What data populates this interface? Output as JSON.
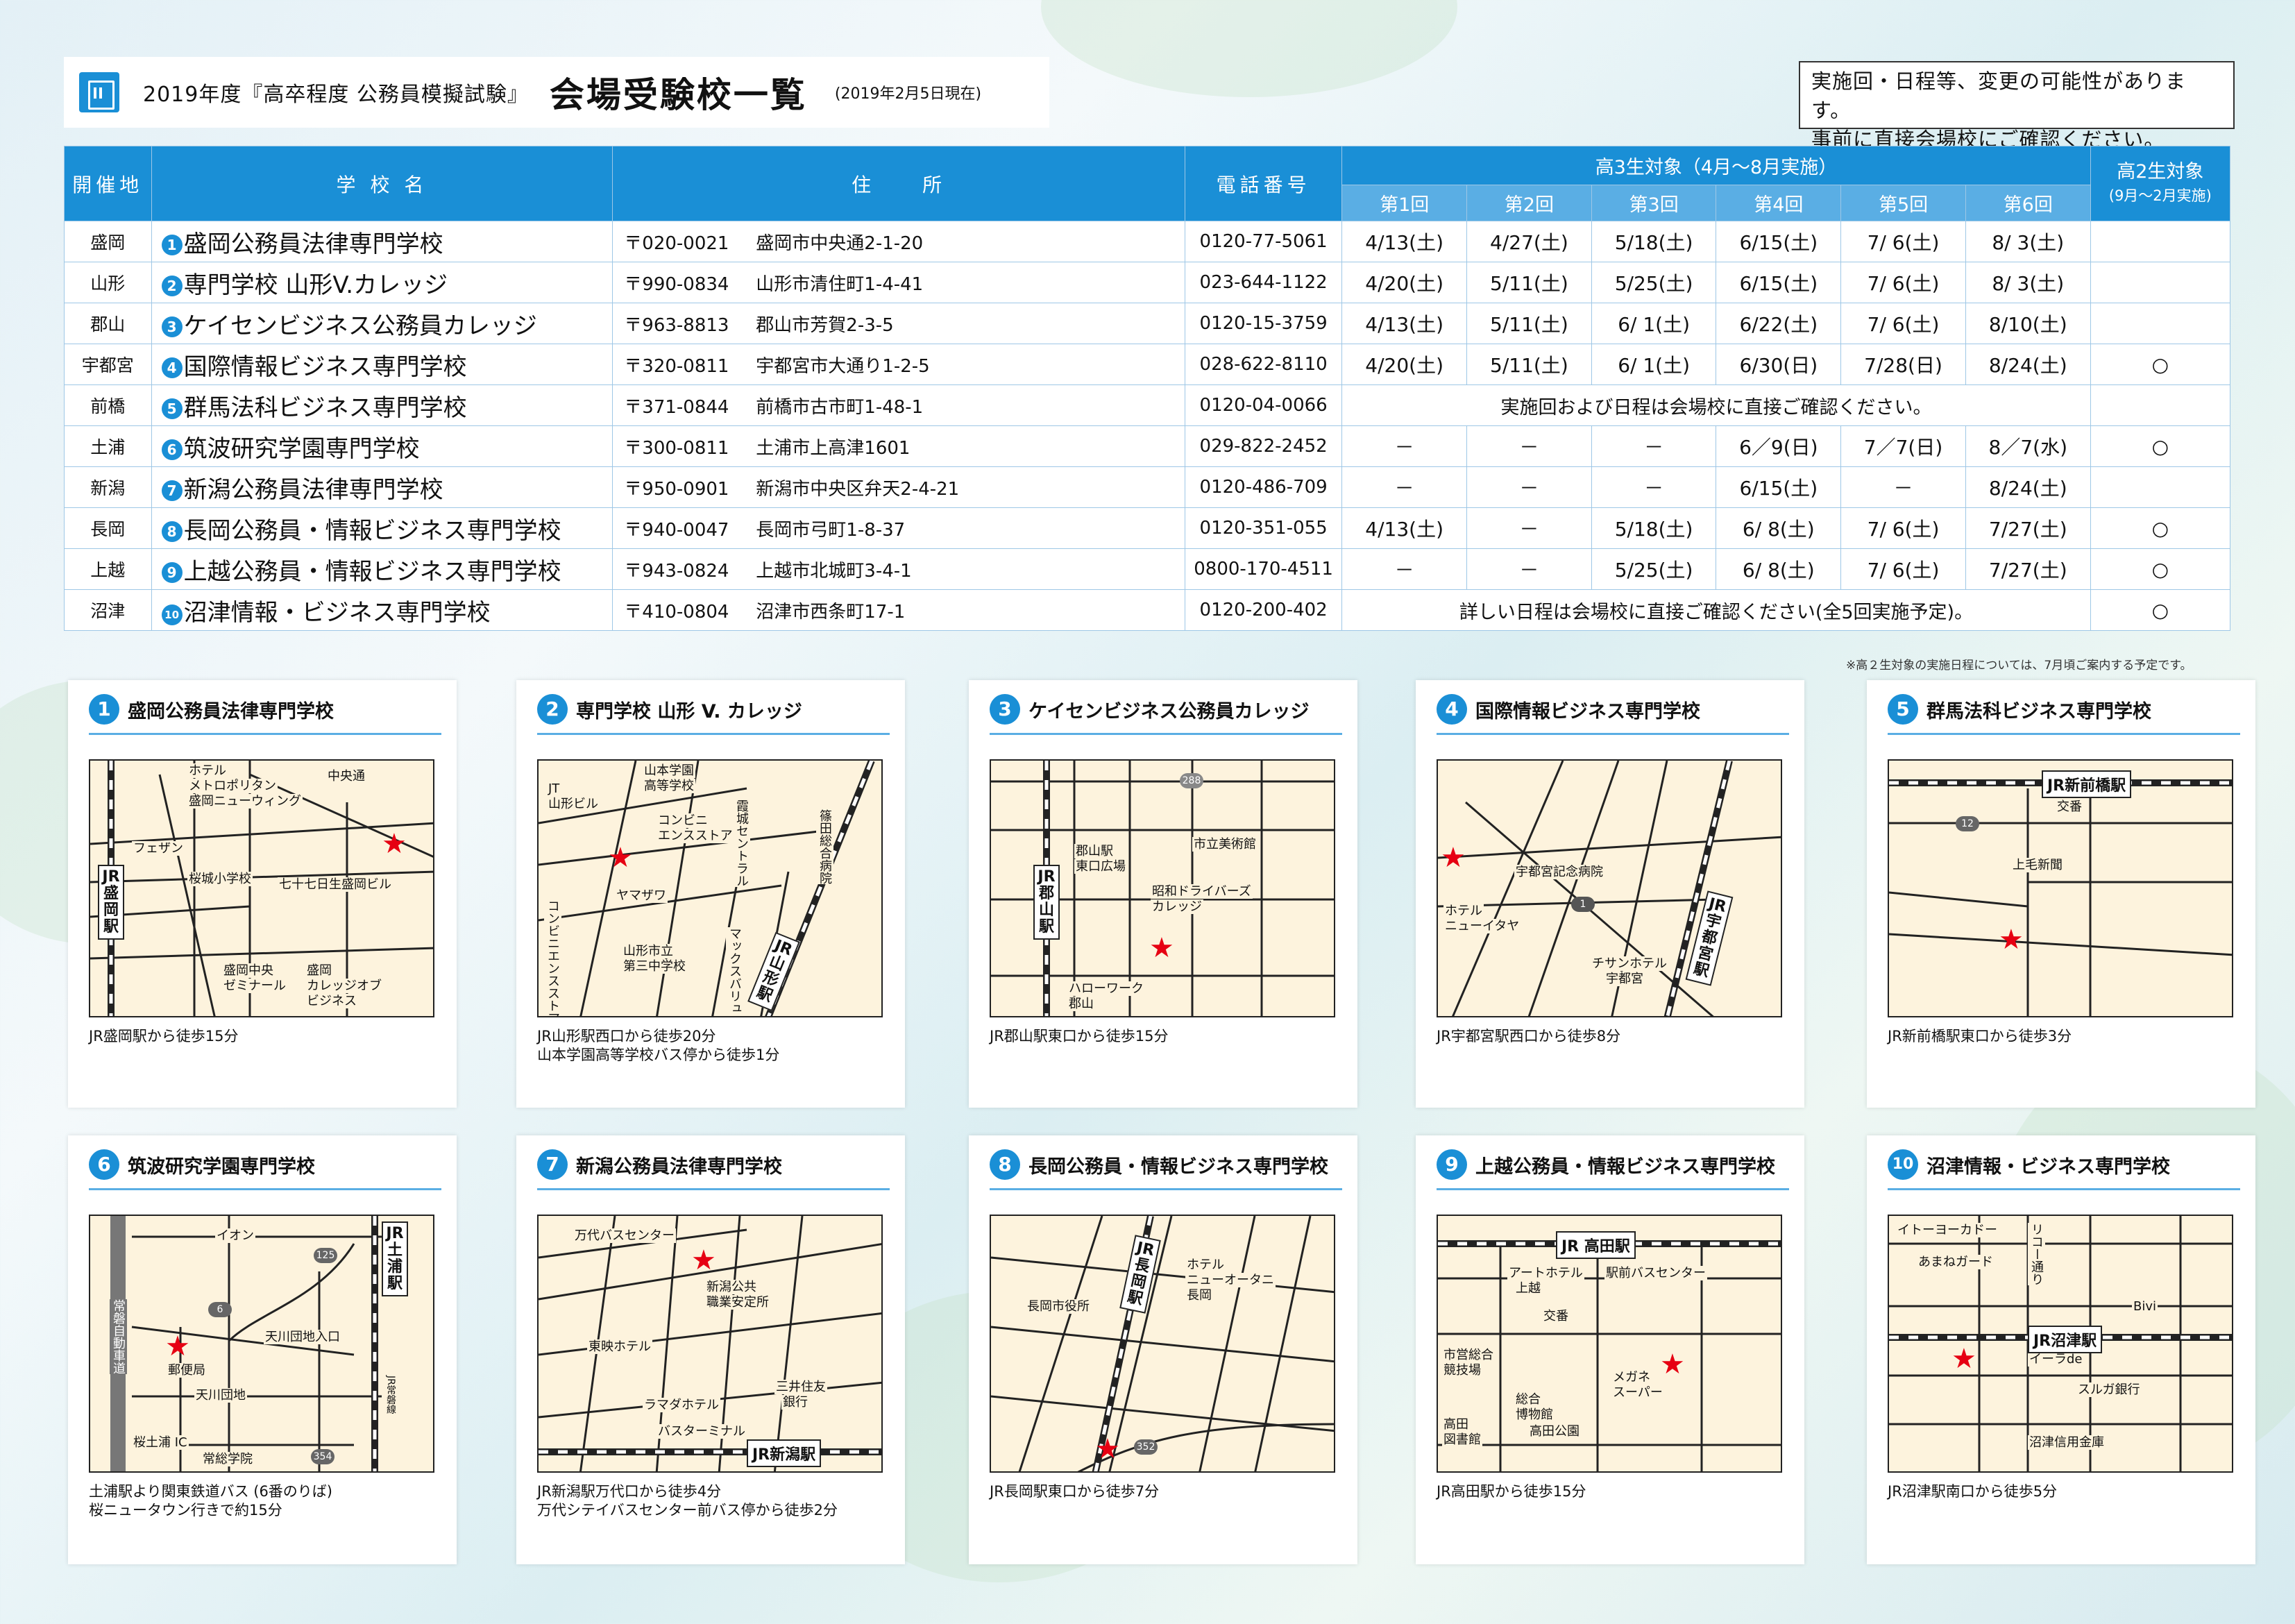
{
  "header": {
    "subtitle": "2019年度『高卒程度 公務員模擬試験』",
    "title": "会場受験校一覧",
    "date": "(2019年2月5日現在)"
  },
  "notice": [
    "実施回・日程等、変更の可能性があります。",
    "事前に直接会場校にご確認ください。"
  ],
  "table": {
    "headers": {
      "place": "開催地",
      "school": "学 校 名",
      "address": "住　　所",
      "phone": "電話番号",
      "g3": "高3生対象（4月～8月実施）",
      "g2": "高2生対象",
      "g2sub": "(9月～2月実施)",
      "rounds": [
        "第1回",
        "第2回",
        "第3回",
        "第4回",
        "第5回",
        "第6回"
      ]
    },
    "rows": [
      {
        "pref": "盛岡",
        "num": "1",
        "school": "盛岡公務員法律専門学校",
        "zip": "〒020-0021",
        "addr": "盛岡市中央通2-1-20",
        "tel": "0120-77-5061",
        "d": [
          "4/13(土)",
          "4/27(土)",
          "5/18(土)",
          "6/15(土)",
          "7/ 6(土)",
          "8/ 3(土)"
        ],
        "k2": ""
      },
      {
        "pref": "山形",
        "num": "2",
        "school": "専門学校 山形V.カレッジ",
        "zip": "〒990-0834",
        "addr": "山形市清住町1-4-41",
        "tel": "023-644-1122",
        "d": [
          "4/20(土)",
          "5/11(土)",
          "5/25(土)",
          "6/15(土)",
          "7/ 6(土)",
          "8/ 3(土)"
        ],
        "k2": ""
      },
      {
        "pref": "郡山",
        "num": "3",
        "school": "ケイセンビジネス公務員カレッジ",
        "zip": "〒963-8813",
        "addr": "郡山市芳賀2-3-5",
        "tel": "0120-15-3759",
        "d": [
          "4/13(土)",
          "5/11(土)",
          "6/ 1(土)",
          "6/22(土)",
          "7/ 6(土)",
          "8/10(土)"
        ],
        "k2": ""
      },
      {
        "pref": "宇都宮",
        "num": "4",
        "school": "国際情報ビジネス専門学校",
        "zip": "〒320-0811",
        "addr": "宇都宮市大通り1-2-5",
        "tel": "028-622-8110",
        "d": [
          "4/20(土)",
          "5/11(土)",
          "6/ 1(土)",
          "6/30(日)",
          "7/28(日)",
          "8/24(土)"
        ],
        "k2": "○"
      },
      {
        "pref": "前橋",
        "num": "5",
        "school": "群馬法科ビジネス専門学校",
        "zip": "〒371-0844",
        "addr": "前橋市古市町1-48-1",
        "tel": "0120-04-0066",
        "merged": "実施回および日程は会場校に直接ご確認ください。",
        "k2": ""
      },
      {
        "pref": "土浦",
        "num": "6",
        "school": "筑波研究学園専門学校",
        "zip": "〒300-0811",
        "addr": "土浦市上高津1601",
        "tel": "029-822-2452",
        "d": [
          "－",
          "－",
          "－",
          "6／9(日)",
          "7／7(日)",
          "8／7(水)"
        ],
        "k2": "○"
      },
      {
        "pref": "新潟",
        "num": "7",
        "school": "新潟公務員法律専門学校",
        "zip": "〒950-0901",
        "addr": "新潟市中央区弁天2-4-21",
        "tel": "0120-486-709",
        "d": [
          "－",
          "－",
          "－",
          "6/15(土)",
          "－",
          "8/24(土)"
        ],
        "k2": ""
      },
      {
        "pref": "長岡",
        "num": "8",
        "school": "長岡公務員・情報ビジネス専門学校",
        "zip": "〒940-0047",
        "addr": "長岡市弓町1-8-37",
        "tel": "0120-351-055",
        "d": [
          "4/13(土)",
          "－",
          "5/18(土)",
          "6/ 8(土)",
          "7/ 6(土)",
          "7/27(土)"
        ],
        "k2": "○"
      },
      {
        "pref": "上越",
        "num": "9",
        "school": "上越公務員・情報ビジネス専門学校",
        "zip": "〒943-0824",
        "addr": "上越市北城町3-4-1",
        "tel": "0800-170-4511",
        "d": [
          "－",
          "－",
          "5/25(土)",
          "6/ 8(土)",
          "7/ 6(土)",
          "7/27(土)"
        ],
        "k2": "○"
      },
      {
        "pref": "沼津",
        "num": "10",
        "school": "沼津情報・ビジネス専門学校",
        "zip": "〒410-0804",
        "addr": "沼津市西条町17-1",
        "tel": "0120-200-402",
        "merged": "詳しい日程は会場校に直接ご確認ください(全5回実施予定)。",
        "k2": "○"
      }
    ]
  },
  "footnote": "※高２生対象の実施日程については、7月頃ご案内する予定です。",
  "maps": [
    {
      "num": "1",
      "title": "盛岡公務員法律専門学校",
      "caption": [
        "JR盛岡駅から徒歩15分"
      ],
      "labels": [
        "ホテル",
        "メトロポリタン",
        "盛岡ニューウィング",
        "中央通",
        "フェザン",
        "桜城小学校",
        "七十七日生盛岡ビル",
        "盛岡中央",
        "ゼミナール",
        "盛岡",
        "カレッジオブ",
        "ビジネス"
      ],
      "station": "JR盛岡駅"
    },
    {
      "num": "2",
      "title": "専門学校 山形 V. カレッジ",
      "caption": [
        "JR山形駅西口から徒歩20分",
        "山本学園高等学校バス停から徒歩1分"
      ],
      "labels": [
        "JT",
        "山形ビル",
        "山本学園",
        "高等学校",
        "コンビニ",
        "エンスストア",
        "霞城セントラル",
        "篠田総合病院",
        "ヤマザワ",
        "コンビニエンスストア",
        "山形市立",
        "第三中学校",
        "マックスバリュ"
      ],
      "station": "JR山形駅"
    },
    {
      "num": "3",
      "title": "ケイセンビジネス公務員カレッジ",
      "caption": [
        "JR郡山駅東口から徒歩15分"
      ],
      "labels": [
        "郡山駅",
        "東口広場",
        "市立美術館",
        "昭和ドライバーズ",
        "カレッジ",
        "ハローワーク",
        "郡山"
      ],
      "station": "JR郡山駅",
      "route": "288"
    },
    {
      "num": "4",
      "title": "国際情報ビジネス専門学校",
      "caption": [
        "JR宇都宮駅西口から徒歩8分"
      ],
      "labels": [
        "宇都宮記念病院",
        "ホテル",
        "ニューイタヤ",
        "チサンホテル",
        "宇都宮"
      ],
      "station": "JR宇都宮駅",
      "route": "1"
    },
    {
      "num": "5",
      "title": "群馬法科ビジネス専門学校",
      "caption": [
        "JR新前橋駅東口から徒歩3分"
      ],
      "labels": [
        "交番",
        "上毛新聞"
      ],
      "station": "JR新前橋駅",
      "route": "12"
    },
    {
      "num": "6",
      "title": "筑波研究学園専門学校",
      "caption": [
        "土浦駅より関東鉄道バス (6番のりば)",
        "桜ニュータウン行きで約15分"
      ],
      "labels": [
        "イオン",
        "天川団地入口",
        "郵便局",
        "天川団地",
        "桜土浦 IC",
        "常総学院",
        "常磐自動車道",
        "JR常磐線"
      ],
      "station": "JR土浦駅",
      "routes": [
        "125",
        "6",
        "354"
      ]
    },
    {
      "num": "7",
      "title": "新潟公務員法律専門学校",
      "caption": [
        "JR新潟駅万代口から徒歩4分",
        "万代シテイバスセンター前バス停から徒歩2分"
      ],
      "labels": [
        "万代バスセンター",
        "新潟公共",
        "職業安定所",
        "東映ホテル",
        "三井住友",
        "銀行",
        "ラマダホテル",
        "バスターミナル"
      ],
      "station": "JR新潟駅"
    },
    {
      "num": "8",
      "title": "長岡公務員・情報ビジネス専門学校",
      "caption": [
        "JR長岡駅東口から徒歩7分"
      ],
      "labels": [
        "ホテル",
        "ニューオータニ",
        "長岡",
        "長岡市役所"
      ],
      "station": "JR長岡駅",
      "route": "352"
    },
    {
      "num": "9",
      "title": "上越公務員・情報ビジネス専門学校",
      "caption": [
        "JR高田駅から徒歩15分"
      ],
      "labels": [
        "アートホテル",
        "上越",
        "駅前バスセンター",
        "交番",
        "市営総合",
        "競技場",
        "総合",
        "博物館",
        "高田公園",
        "高田",
        "図書館",
        "メガネ",
        "スーパー"
      ],
      "station": "JR 高田駅"
    },
    {
      "num": "10",
      "title": "沼津情報・ビジネス専門学校",
      "caption": [
        "JR沼津駅南口から徒歩5分"
      ],
      "labels": [
        "イトーヨーカドー",
        "あまねガード",
        "リコー通り",
        "Bivi",
        "イーラde",
        "スルガ銀行",
        "沼津信用金庫"
      ],
      "station": "JR沼津駅"
    }
  ],
  "colors": {
    "accent": "#1a8fd6",
    "header_light": "#5aaee4",
    "star": "#e60012",
    "map_bg": "#fdf3dd"
  }
}
